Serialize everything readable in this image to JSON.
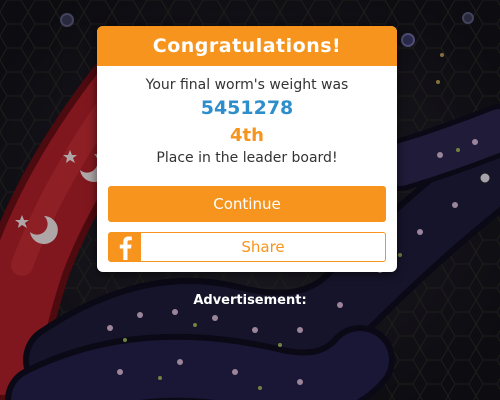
{
  "modal": {
    "title": "Congratulations!",
    "weight_text": "Your final worm's weight was",
    "weight_value": "5451278",
    "place_value": "4th",
    "place_text": "Place in the leader board!",
    "continue_label": "Continue",
    "share_label": "Share",
    "share_icon": "facebook-icon"
  },
  "advertisement": {
    "label": "Advertisement:"
  },
  "colors": {
    "accent_orange": "#f7941d",
    "score_blue": "#2e8ecb",
    "worm_red": "#b3202a",
    "worm_navy": "#1f1d3c"
  }
}
